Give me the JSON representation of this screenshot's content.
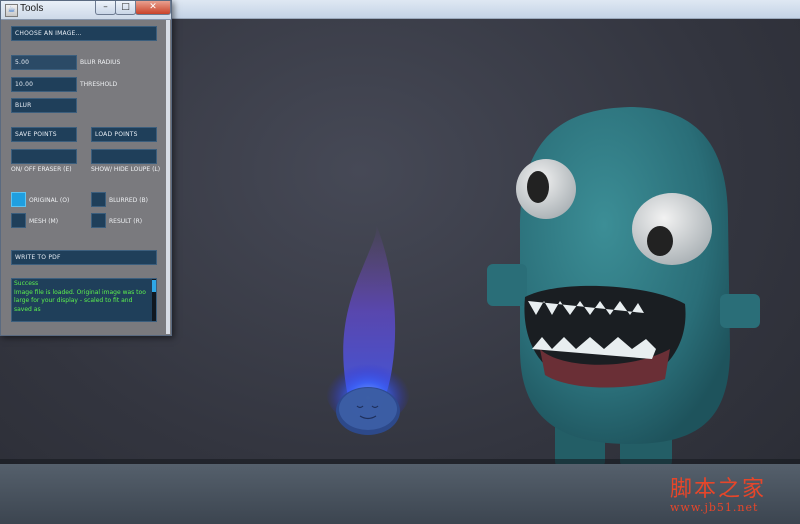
{
  "window": {
    "title": "Tools",
    "controls": [
      "minimize",
      "maximize",
      "close"
    ]
  },
  "tools": {
    "choose_image": "CHOOSE AN IMAGE...",
    "blur_radius": {
      "value": "5.00",
      "label": "BLUR RADIUS"
    },
    "threshold": {
      "value": "10.00",
      "label": "THRESHOLD"
    },
    "blur_button": "BLUR",
    "save_points": "SAVE POINTS",
    "load_points": "LOAD POINTS",
    "eraser_label": "ON/ OFF ERASER (E)",
    "loupe_label": "SHOW/ HIDE LOUPE (L)",
    "views": [
      {
        "label": "ORIGINAL (O)",
        "selected": true
      },
      {
        "label": "BLURRED (B)",
        "selected": false
      },
      {
        "label": "MESH (M)",
        "selected": false
      },
      {
        "label": "RESULT (R)",
        "selected": false
      }
    ],
    "write_pdf": "WRITE TO PDF",
    "status_lines": [
      "Success",
      "Image file is loaded. Original image was too",
      "large for your display - scaled to fit and",
      "saved as"
    ]
  },
  "watermark": {
    "title": "脚本之家",
    "url": "www.jb51.net"
  },
  "colors": {
    "panel_bg": "#7a7a7e",
    "control_bg": "#1f3f5a",
    "selected_toggle": "#1f9fe0",
    "status_text": "#5df04e",
    "watermark": "#e6462a"
  }
}
